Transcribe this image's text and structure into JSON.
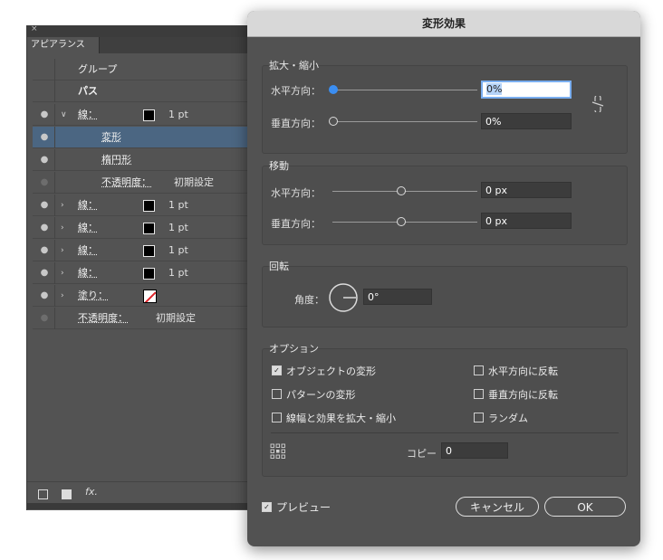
{
  "appearance_panel": {
    "close_glyph": "×",
    "tab_label": "アピアランス",
    "rows": [
      {
        "label": "グループ",
        "value": ""
      },
      {
        "label": "パス",
        "value": ""
      },
      {
        "eye": "eye-icon",
        "chevron": "∨",
        "label": "線：",
        "value": "1 pt"
      },
      {
        "eye": "eye-icon",
        "label": "変形"
      },
      {
        "eye": "eye-icon",
        "label": "楕円形"
      },
      {
        "label": "不透明度：",
        "value": "初期設定"
      },
      {
        "eye": "eye-icon",
        "chevron": "›",
        "label": "線：",
        "value": "1 pt"
      },
      {
        "eye": "eye-icon",
        "chevron": "›",
        "label": "線：",
        "value": "1 pt"
      },
      {
        "eye": "eye-icon",
        "chevron": "›",
        "label": "線：",
        "value": "1 pt"
      },
      {
        "eye": "eye-icon",
        "chevron": "›",
        "label": "線：",
        "value": "1 pt"
      },
      {
        "eye": "eye-icon",
        "chevron": "›",
        "label": "塗り："
      },
      {
        "label": "不透明度：",
        "value": "初期設定"
      }
    ],
    "fx_label": "fx."
  },
  "dialog": {
    "title": "変形効果",
    "scale": {
      "legend": "拡大・縮小",
      "h_label": "水平方向：",
      "h_value": "0%",
      "v_label": "垂直方向：",
      "v_value": "0%"
    },
    "move": {
      "legend": "移動",
      "h_label": "水平方向：",
      "h_value": "0 px",
      "v_label": "垂直方向：",
      "v_value": "0 px"
    },
    "rotate": {
      "legend": "回転",
      "angle_label": "角度：",
      "angle_value": "0°"
    },
    "options": {
      "legend": "オプション",
      "transform_objects": "オブジェクトの変形",
      "transform_patterns": "パターンの変形",
      "scale_strokes": "線幅と効果を拡大・縮小",
      "reflect_x": "水平方向に反転",
      "reflect_y": "垂直方向に反転",
      "random": "ランダム",
      "copies_label": "コピー",
      "copies_value": "0"
    },
    "preview_label": "プレビュー",
    "cancel_label": "キャンセル",
    "ok_label": "OK"
  },
  "colors": {
    "panel_bg": "#535353",
    "selected_row": "#4b6682",
    "focus_blue": "#3b8ef2",
    "fill_none_red": "#e0242a"
  }
}
